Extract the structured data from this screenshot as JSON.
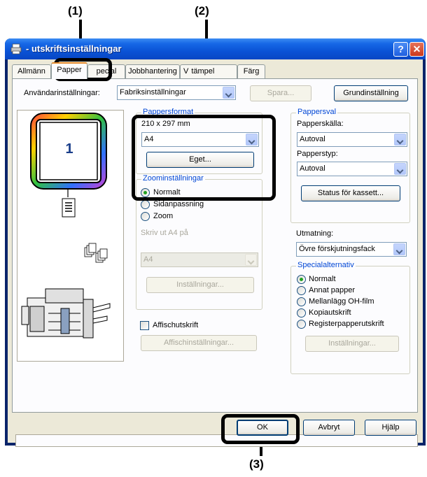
{
  "callouts": {
    "c1": "(1)",
    "c2": "(2)",
    "c3": "(3)"
  },
  "window": {
    "title": "- utskriftsinställningar",
    "help_label": "?",
    "close_label": "✕"
  },
  "tabs": [
    {
      "label": "Allmänn"
    },
    {
      "label": "Papper"
    },
    {
      "label": "pecial"
    },
    {
      "label": "Jobbhantering"
    },
    {
      "label": "V"
    },
    {
      "label": "tämpel"
    },
    {
      "label": "Färg"
    }
  ],
  "user_settings": {
    "label": "Användarinställningar:",
    "value": "Fabriksinställningar",
    "save_label": "Spara...",
    "default_label": "Grundinställning"
  },
  "preview": {
    "page_number": "1"
  },
  "paper_format": {
    "group_label": "Pappersformat",
    "size_text": "210 x 297 mm",
    "value": "A4",
    "custom_label": "Eget..."
  },
  "zoom": {
    "group_label": "Zoominställningar",
    "options": [
      {
        "label": "Normalt",
        "selected": true
      },
      {
        "label": "Sidanpassning",
        "selected": false
      },
      {
        "label": "Zoom",
        "selected": false
      }
    ],
    "print_on_label": "Skriv ut A4 på",
    "print_on_value": "A4",
    "settings_label": "Inställningar..."
  },
  "poster": {
    "label": "Affischutskrift",
    "settings_label": "Affischinställningar..."
  },
  "paper_select": {
    "group_label": "Pappersval",
    "source_label": "Papperskälla:",
    "source_value": "Autoval",
    "type_label": "Papperstyp:",
    "type_value": "Autoval",
    "status_label": "Status för kassett..."
  },
  "output": {
    "label": "Utmatning:",
    "value": "Övre förskjutningsfack"
  },
  "special": {
    "group_label": "Specialalternativ",
    "options": [
      {
        "label": "Normalt",
        "selected": true
      },
      {
        "label": "Annat papper",
        "selected": false
      },
      {
        "label": "Mellanlägg OH-film",
        "selected": false
      },
      {
        "label": "Kopiautskrift",
        "selected": false
      },
      {
        "label": "Registerpapperutskrift",
        "selected": false
      }
    ],
    "settings_label": "Inställningar..."
  },
  "footer": {
    "ok_label": "OK",
    "cancel_label": "Avbryt",
    "help_label": "Hjälp"
  }
}
